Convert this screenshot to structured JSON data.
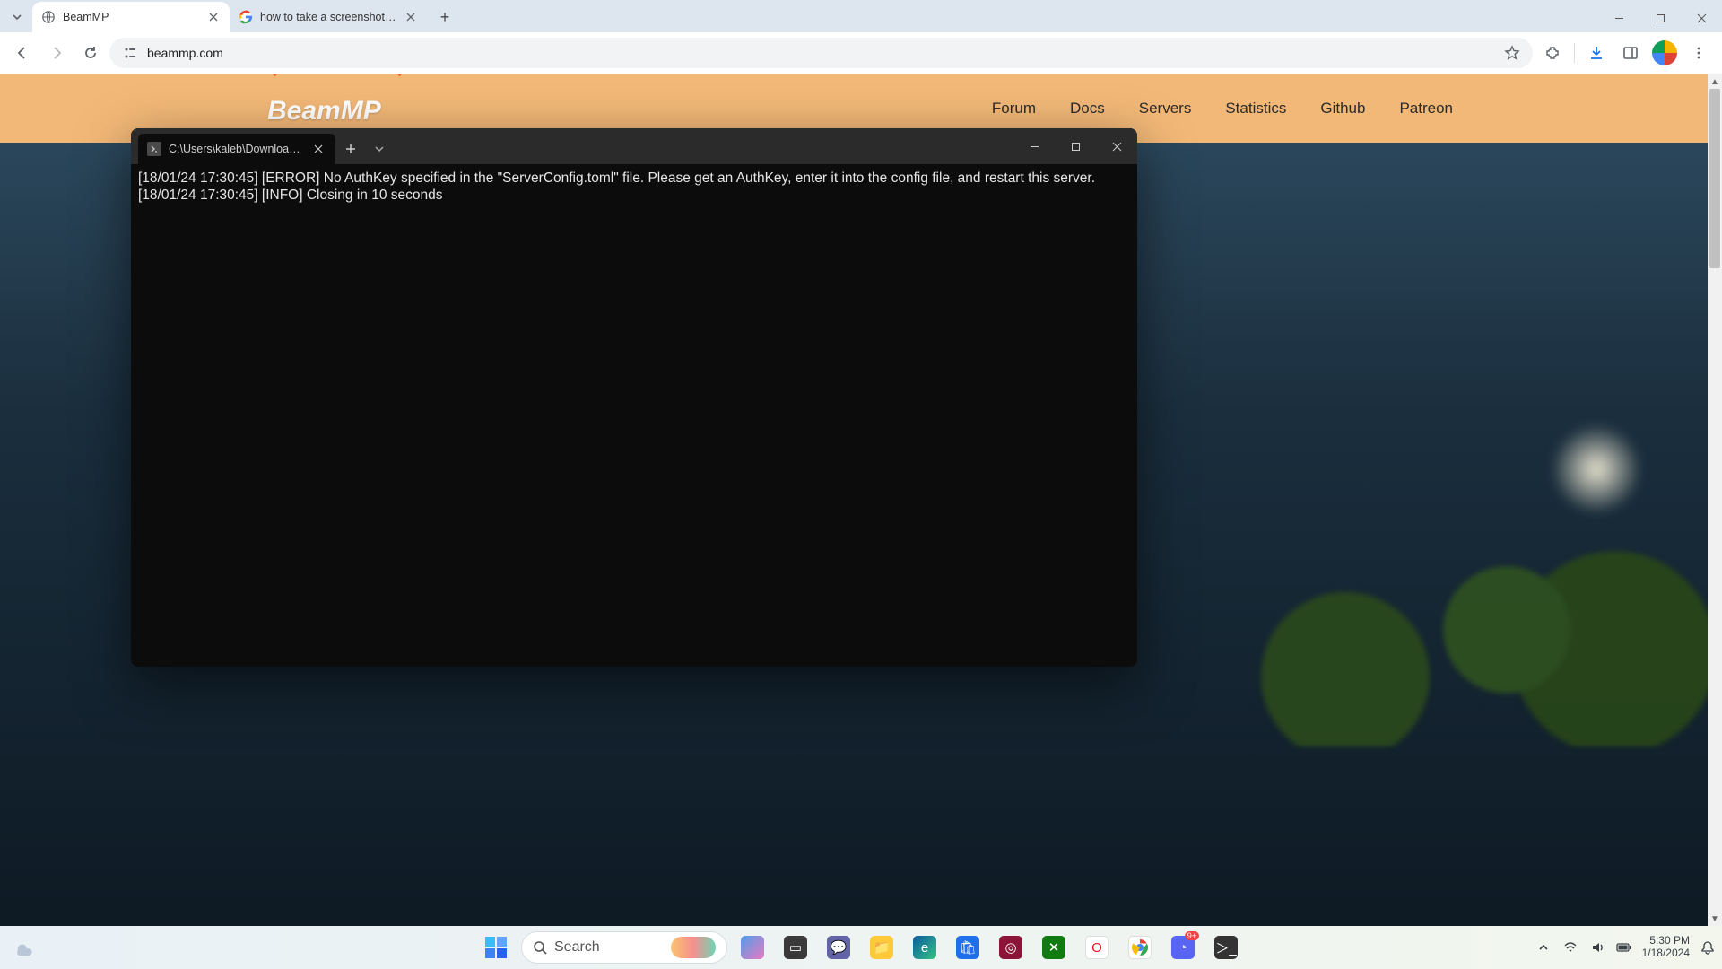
{
  "browser": {
    "tabs": [
      {
        "title": "BeamMP",
        "favicon": "globe",
        "active": true
      },
      {
        "title": "how to take a screenshot on u…",
        "favicon": "google",
        "active": false
      }
    ],
    "url": "beammp.com",
    "win_min": "—",
    "win_max": "▢",
    "win_close": "✕"
  },
  "page": {
    "logo_text": "BeamMP",
    "nav": [
      "Forum",
      "Docs",
      "Servers",
      "Statistics",
      "Github",
      "Patreon"
    ]
  },
  "terminal": {
    "tab_title": "C:\\Users\\kaleb\\Downloads\\Be",
    "lines": [
      "[18/01/24 17:30:45] [ERROR] No AuthKey specified in the \"ServerConfig.toml\" file. Please get an AuthKey, enter it into the config file, and restart this server.",
      "[18/01/24 17:30:45] [INFO] Closing in 10 seconds"
    ]
  },
  "taskbar": {
    "search_placeholder": "Search",
    "time": "5:30 PM",
    "date": "1/18/2024",
    "notify_badge": "9+"
  }
}
